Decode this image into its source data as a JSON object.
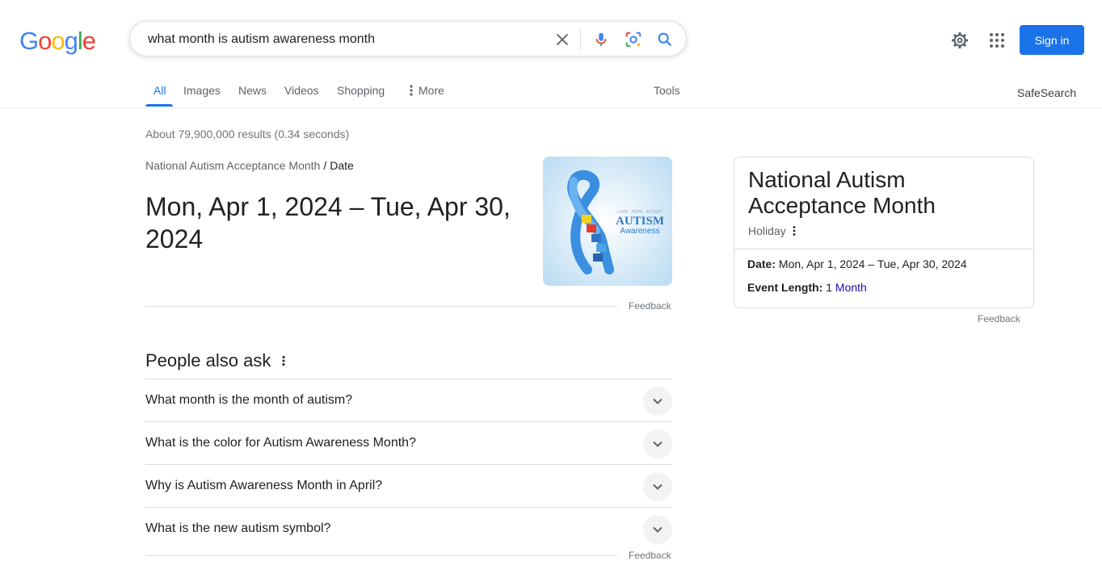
{
  "logo": {
    "letters": [
      "G",
      "o",
      "o",
      "g",
      "l",
      "e"
    ]
  },
  "search": {
    "query": "what month is autism awareness month"
  },
  "header": {
    "sign_in": "Sign in"
  },
  "tabs": [
    {
      "label": "All"
    },
    {
      "label": "Images"
    },
    {
      "label": "News"
    },
    {
      "label": "Videos"
    },
    {
      "label": "Shopping"
    },
    {
      "label": "More"
    }
  ],
  "tools_label": "Tools",
  "safesearch_label": "SafeSearch",
  "stats": "About 79,900,000 results (0.34 seconds)",
  "featured": {
    "crumb_parent": "National Autism Acceptance Month",
    "crumb_sep": "/",
    "crumb_current": "Date",
    "answer": "Mon, Apr 1, 2024 – Tue, Apr 30, 2024",
    "image_text_top": "LOVE · HOPE · ACCEPT",
    "image_text_main": "AUTISM",
    "image_text_sub": "Awareness",
    "feedback": "Feedback"
  },
  "paa": {
    "title": "People also ask",
    "questions": [
      "What month is the month of autism?",
      "What is the color for Autism Awareness Month?",
      "Why is Autism Awareness Month in April?",
      "What is the new autism symbol?"
    ],
    "feedback": "Feedback"
  },
  "knowledge_panel": {
    "title": "National Autism Acceptance Month",
    "subtitle": "Holiday",
    "date_label": "Date:",
    "date_value": "Mon, Apr 1, 2024 – Tue, Apr 30, 2024",
    "length_label": "Event Length:",
    "length_number": "1",
    "length_unit": "Month",
    "feedback": "Feedback"
  },
  "colors": {
    "accent": "#1a73e8",
    "link": "#1a0dab"
  }
}
